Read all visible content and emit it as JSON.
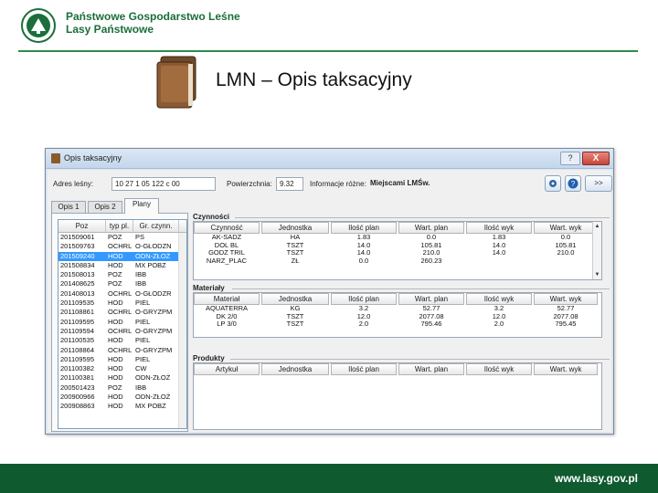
{
  "header": {
    "org_line1": "Państwowe Gospodarstwo Leśne",
    "org_line2": "Lasy Państwowe",
    "slide_title": "LMN – Opis taksacyjny"
  },
  "window": {
    "title": "Opis taksacyjny",
    "help": "?",
    "close": "X"
  },
  "toolbar": {
    "address_label": "Adres leśny:",
    "address_value": "10 27 1 05 122   c  00",
    "area_label": "Powierzchnia:",
    "area_value": "9.32",
    "info_label": "Informacje różne:",
    "info_value": "Miejscami LMŚw.",
    "next_label": ">>"
  },
  "tabs": [
    "Opis 1",
    "Opis 2",
    "Plany"
  ],
  "list": {
    "columns": [
      "Poz",
      "typ pl.",
      "Gr. czynn."
    ],
    "rows": [
      [
        "201509061",
        "POZ",
        "PS"
      ],
      [
        "201509763",
        "OCHRL",
        "O-GŁODZN"
      ],
      [
        "201509240",
        "HOD",
        "ODN-ZŁOŻ"
      ],
      [
        "201508834",
        "HOD",
        "MX POBZ"
      ],
      [
        "201508013",
        "POZ",
        "IBB"
      ],
      [
        "201408625",
        "POZ",
        "IBB"
      ],
      [
        "201408013",
        "OCHRL",
        "O-GŁODZR"
      ],
      [
        "201109535",
        "HOD",
        "PIEL"
      ],
      [
        "201108861",
        "OCHRL",
        "O-GRYZPM"
      ],
      [
        "201109595",
        "HOD",
        "PIEL"
      ],
      [
        "201109594",
        "OCHRL",
        "O-GRYZPM"
      ],
      [
        "201100535",
        "HOD",
        "PIEL"
      ],
      [
        "201108864",
        "OCHRL",
        "O-GRYZPM"
      ],
      [
        "201109595",
        "HOD",
        "PIEL"
      ],
      [
        "201100382",
        "HOD",
        "CW"
      ],
      [
        "201100381",
        "HOD",
        "ODN-ZŁOŻ"
      ],
      [
        "200501423",
        "POZ",
        "IBB"
      ],
      [
        "200900966",
        "HOD",
        "ODN-ZŁOŻ"
      ],
      [
        "200908863",
        "HOD",
        "MX POBZ"
      ]
    ],
    "selected_index": 2
  },
  "czynnosci": {
    "title": "Czynności",
    "columns": [
      "Czynność",
      "Jednostka",
      "Ilość plan",
      "Wart. plan",
      "Ilość wyk",
      "Wart. wyk"
    ],
    "rows": [
      [
        "AK-SADZ",
        "HA",
        "1.83",
        "0.0",
        "1.83",
        "0.0"
      ],
      [
        "DOL BL",
        "TSZT",
        "14.0",
        "105.81",
        "14.0",
        "105.81"
      ],
      [
        "GODZ TRIL",
        "TSZT",
        "14.0",
        "210.0",
        "14.0",
        "210.0"
      ],
      [
        "NARZ_PLAC",
        "ZŁ",
        "0.0",
        "260.23",
        "",
        ""
      ]
    ]
  },
  "materialy": {
    "title": "Materiały",
    "columns": [
      "Materiał",
      "Jednostka",
      "Ilość plan",
      "Wart. plan",
      "Ilość wyk",
      "Wart. wyk"
    ],
    "rows": [
      [
        "AQUATERRA",
        "KG",
        "3.2",
        "52.77",
        "3.2",
        "52.77"
      ],
      [
        "DK 2/0",
        "TSZT",
        "12.0",
        "2077.08",
        "12.0",
        "2077.08"
      ],
      [
        "LP 3/0",
        "TSZT",
        "2.0",
        "795.46",
        "2.0",
        "795.45"
      ]
    ]
  },
  "produkty": {
    "title": "Produkty",
    "columns": [
      "Artykuł",
      "Jednostka",
      "Ilość plan",
      "Wart. plan",
      "Ilość wyk",
      "Wart. wyk"
    ]
  },
  "footer": {
    "url": "www.lasy.gov.pl"
  },
  "colors": {
    "brand_green": "#0f5a2e",
    "selection": "#3399ff"
  }
}
